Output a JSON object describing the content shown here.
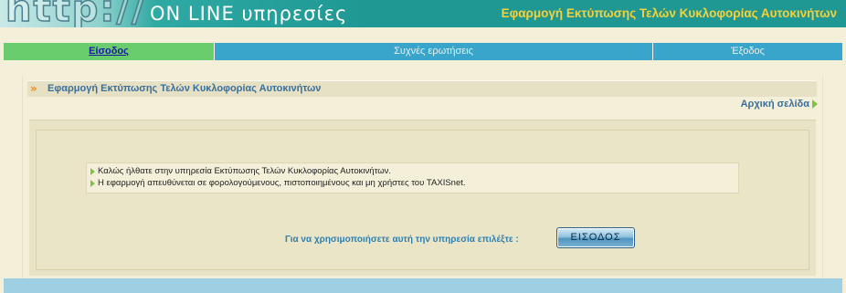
{
  "header": {
    "logo_url": "http://",
    "logo_services": "ON LINE υπηρεσίες",
    "app_title": "Εφαρμογή Εκτύπωσης Τελών Κυκλοφορίας Αυτοκινήτων"
  },
  "nav": {
    "tabs": [
      {
        "label": "Είσοδος",
        "active": true
      },
      {
        "label": "Συχνές ερωτήσεις",
        "active": false
      },
      {
        "label": "Έξοδος",
        "active": false
      }
    ]
  },
  "panel": {
    "title": "Εφαρμογή Εκτύπωσης Τελών Κυκλοφορίας Αυτοκινήτων",
    "home_link": "Αρχική σελίδα",
    "info_lines": [
      "Καλώς ήλθατε στην υπηρεσία Εκτύπωσης Τελών Κυκλοφορίας Αυτοκινήτων.",
      "Η εφαρμογή απευθύνεται σε φορολογούμενους, πιστοποιημένους και μη χρήστες του TAXISnet."
    ],
    "prompt": "Για να χρησιμοποιήσετε αυτή την υπηρεσία επιλέξτε :",
    "enter_button": "ΕΙΣΟΔΟΣ"
  },
  "colors": {
    "header_teal": "#1f9893",
    "app_title_yellow": "#f5d13a",
    "nav_active_green": "#6acd6d",
    "nav_blue": "#39a5cb",
    "panel_beige": "#f3efd9",
    "link_blue": "#3a6f9c",
    "bullet_green": "#7ec24a"
  }
}
